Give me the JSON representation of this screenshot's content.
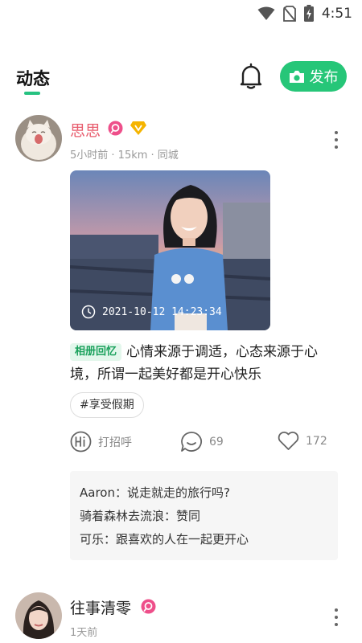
{
  "status_bar": {
    "time": "4:51",
    "icons": [
      "wifi-icon",
      "no-sim-icon",
      "battery-charging-icon"
    ]
  },
  "header": {
    "tab_title": "动态",
    "post_button_label": "发布",
    "icons": [
      "bell-icon",
      "camera-icon"
    ]
  },
  "colors": {
    "accent_green": "#26c678",
    "username_pink": "#e85c6d",
    "badge_pink": "#ee4f8a",
    "vip_gold": "#f5b400"
  },
  "posts": [
    {
      "username": "思思",
      "meta": "5小时前 · 15km · 同城",
      "photo_timestamp": "2021-10-12 14:23:34",
      "album_tag": "相册回忆",
      "text": "心情来源于调适，心态来源于心境，所谓一起美好都是开心快乐",
      "hashtag": "#享受假期",
      "actions": {
        "greet_label": "打招呼",
        "comment_count": "69",
        "like_count": "172"
      },
      "comments": [
        {
          "author": "Aaron",
          "sep": "：",
          "text": "说走就走的旅行吗?"
        },
        {
          "author": "骑着森林去流浪",
          "sep": "：",
          "text": "赞同"
        },
        {
          "author": "可乐",
          "sep": "：",
          "text": "跟喜欢的人在一起更开心"
        }
      ]
    },
    {
      "username": "往事清零",
      "meta": "1天前"
    }
  ]
}
